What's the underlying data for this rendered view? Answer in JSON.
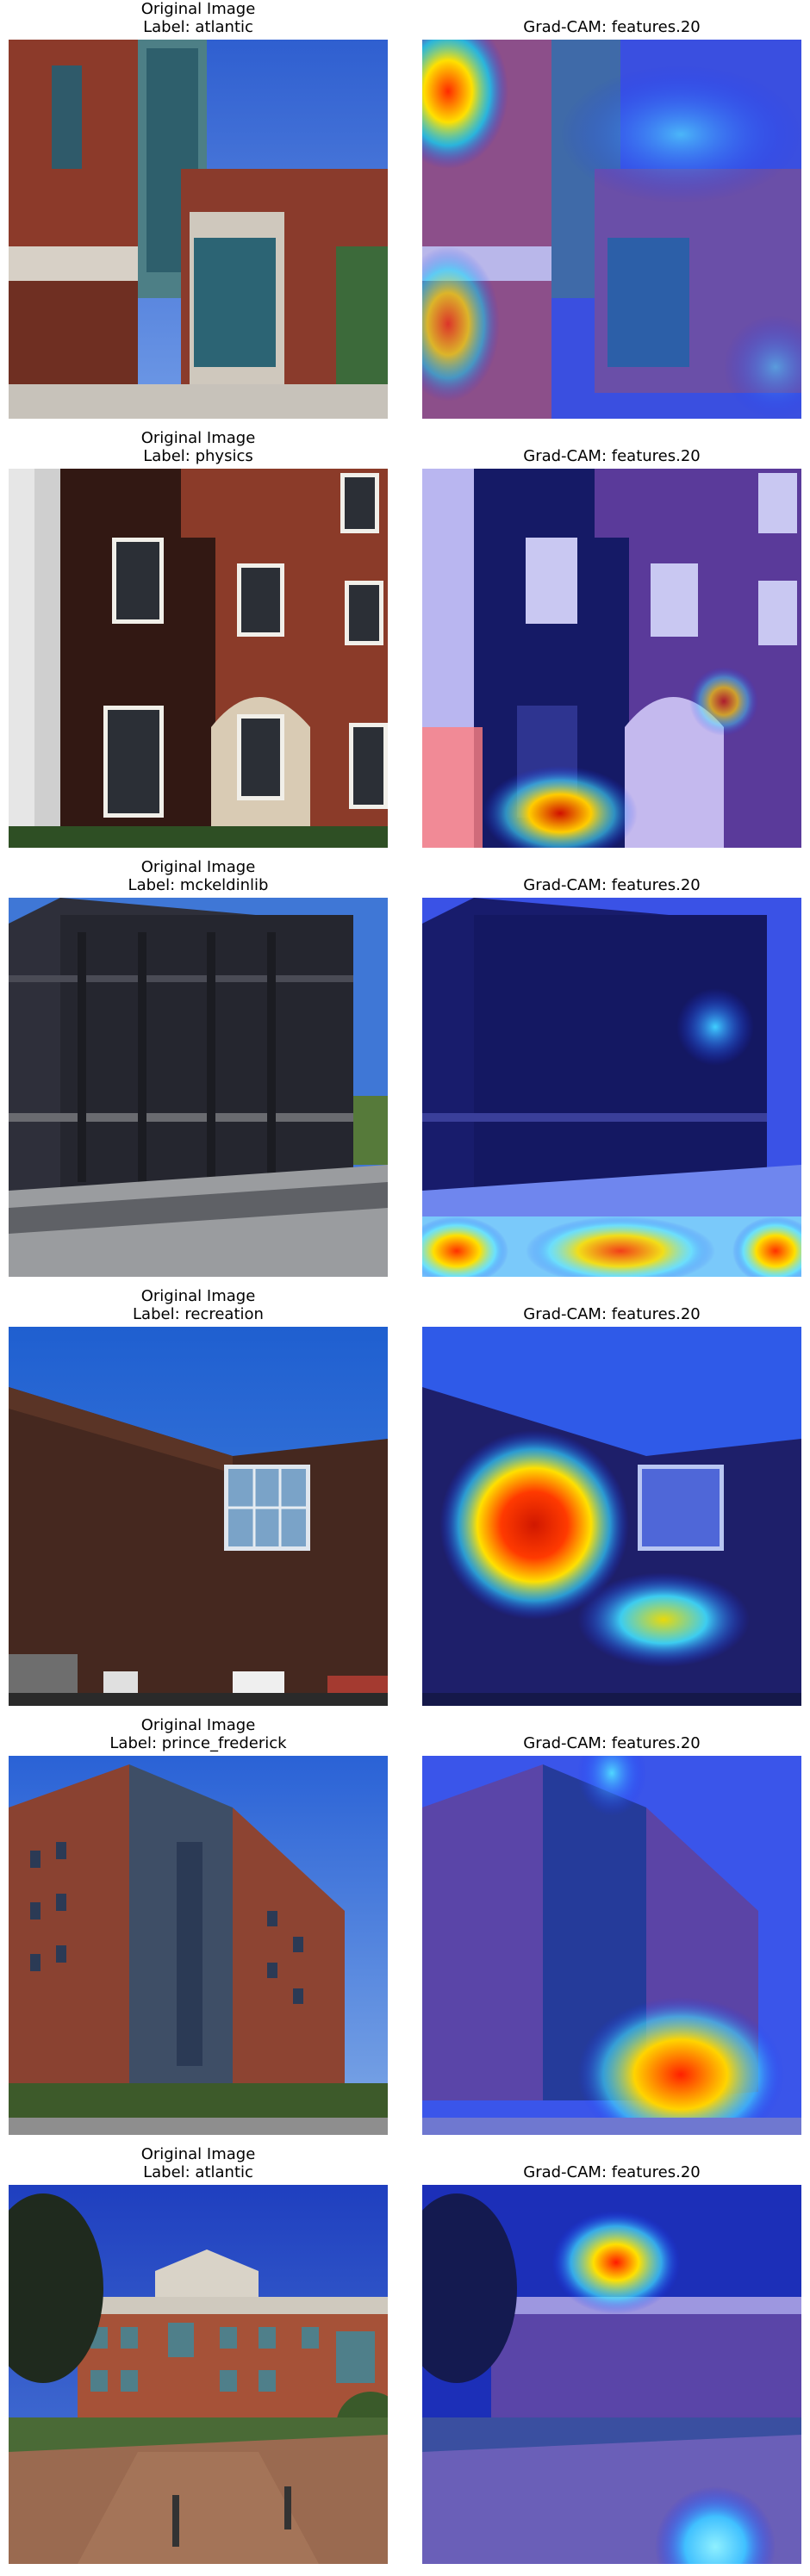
{
  "rows": [
    {
      "original": {
        "title": "Original Image",
        "label": "Label: atlantic",
        "scene": "brick-building-with-glass-tower"
      },
      "gradcam": {
        "title": "Grad-CAM: features.20"
      }
    },
    {
      "original": {
        "title": "Original Image",
        "label": "Label: physics",
        "scene": "brick-wall-with-windows"
      },
      "gradcam": {
        "title": "Grad-CAM: features.20"
      }
    },
    {
      "original": {
        "title": "Original Image",
        "label": "Label: mckeldinlib",
        "scene": "dark-building-corner"
      },
      "gradcam": {
        "title": "Grad-CAM: features.20"
      }
    },
    {
      "original": {
        "title": "Original Image",
        "label": "Label: recreation",
        "scene": "brick-wall-with-window-and-cars"
      },
      "gradcam": {
        "title": "Grad-CAM: features.20"
      }
    },
    {
      "original": {
        "title": "Original Image",
        "label": "Label: prince_frederick",
        "scene": "tall-brick-dormitory"
      },
      "gradcam": {
        "title": "Grad-CAM: features.20"
      }
    },
    {
      "original": {
        "title": "Original Image",
        "label": "Label: atlantic",
        "scene": "brick-building-with-plaza"
      },
      "gradcam": {
        "title": "Grad-CAM: features.20"
      }
    }
  ],
  "colors": {
    "sky": "#3b6fd6",
    "brick": "#8a3b2a",
    "heatmap_cool": "#1a2cff",
    "heatmap_hot": "#ff2a00"
  }
}
